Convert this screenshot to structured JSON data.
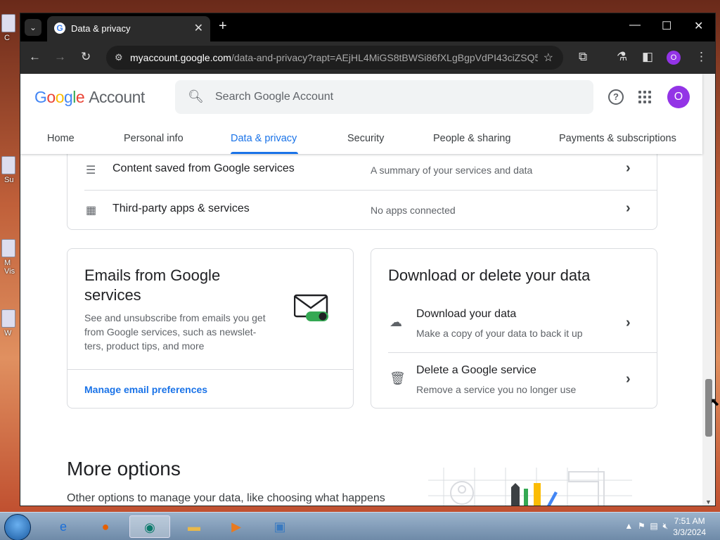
{
  "desktop": {
    "icons": [
      "C",
      "Su",
      "M Vis",
      "W"
    ]
  },
  "browser": {
    "tab_title": "Data & privacy",
    "url_domain": "myaccount.google.com",
    "url_path": "/data-and-privacy?rapt=AEjHL4MiGS8tBWSi86fXLgBgpVdPI43ciZSQ5...",
    "profile_initial": "O"
  },
  "header": {
    "logo_google": "Google",
    "logo_account": "Account",
    "search_placeholder": "Search Google Account",
    "avatar_initial": "O"
  },
  "nav": {
    "items": [
      "Home",
      "Personal info",
      "Data & privacy",
      "Security",
      "People & sharing",
      "Payments & subscriptions"
    ],
    "active": "Data & privacy"
  },
  "data_list": {
    "rows": [
      {
        "label": "Content saved from Google services",
        "desc": "A summary of your services and data"
      },
      {
        "label": "Third-party apps & services",
        "desc": "No apps connected"
      }
    ]
  },
  "emails_card": {
    "title": "Emails from Google services",
    "body": "See and unsubscribe from emails you get from Google services, such as newslet- ters, product tips, and more",
    "link": "Manage email preferences"
  },
  "download_card": {
    "title": "Download or delete your data",
    "rows": [
      {
        "label": "Download your data",
        "desc": "Make a copy of your data to back it up"
      },
      {
        "label": "Delete a Google service",
        "desc": "Remove a service you no longer use"
      }
    ]
  },
  "more_options": {
    "title": "More options",
    "body": "Other options to manage your data, like choosing what happens"
  },
  "taskbar": {
    "time": "7:51 AM",
    "date": "3/3/2024"
  }
}
